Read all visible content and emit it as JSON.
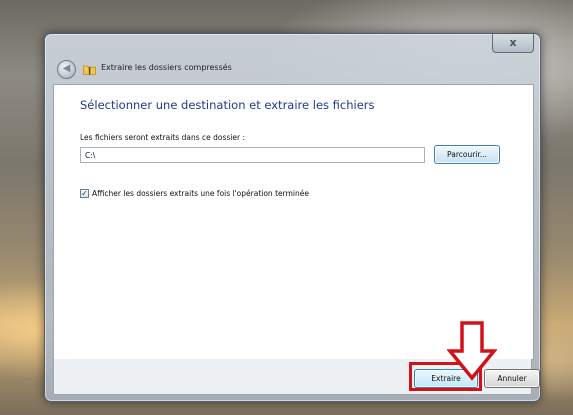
{
  "window": {
    "title": "Extraire les dossiers compressés",
    "close_label": "x",
    "back_label": "◀"
  },
  "content": {
    "heading": "Sélectionner une destination et extraire les fichiers",
    "destination_label": "Les fichiers seront extraits dans ce dossier :",
    "destination_value": "C:\\",
    "browse_label": "Parcourir...",
    "show_folders_checked": true,
    "show_folders_check_glyph": "✓",
    "show_folders_label": "Afficher les dossiers extraits une fois l'opération terminée"
  },
  "footer": {
    "extract_label": "Extraire",
    "cancel_label": "Annuler"
  },
  "annotation": {
    "arrow_icon": "down-arrow-outline-icon",
    "highlight_color": "#d0121b"
  }
}
